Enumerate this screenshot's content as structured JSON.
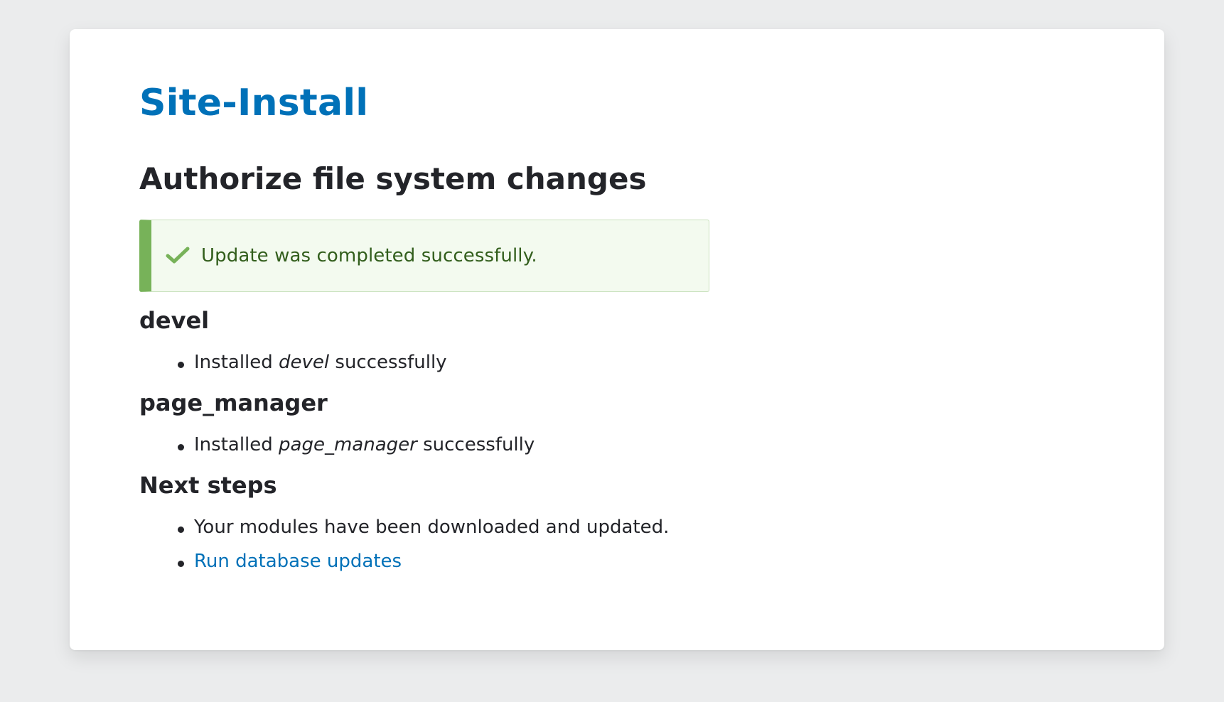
{
  "site_name": "Site-Install",
  "page_title": "Authorize file system changes",
  "status_message": {
    "text": "Update was completed successfully.",
    "icon": "checkmark-icon",
    "colors": {
      "accent": "#77b259",
      "background": "#f3faef",
      "text": "#325e1c"
    }
  },
  "modules": [
    {
      "name": "devel",
      "message": {
        "prefix": "Installed ",
        "module": "devel",
        "suffix": " successfully"
      }
    },
    {
      "name": "page_manager",
      "message": {
        "prefix": "Installed ",
        "module": "page_manager",
        "suffix": " successfully"
      }
    }
  ],
  "next_steps": {
    "heading": "Next steps",
    "items": [
      {
        "text": "Your modules have been downloaded and updated."
      }
    ],
    "link": {
      "text": "Run database updates"
    }
  },
  "colors": {
    "link": "#0071b8",
    "text": "#232429",
    "page_background": "#ebeced"
  }
}
